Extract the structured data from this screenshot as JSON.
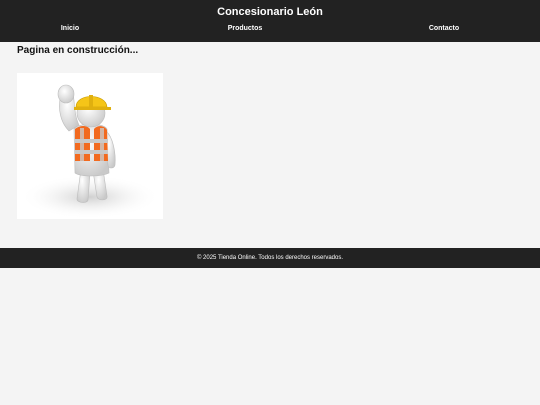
{
  "header": {
    "title": "Concesionario León",
    "nav": {
      "inicio": "Inicio",
      "productos": "Productos",
      "contacto": "Contacto"
    }
  },
  "main": {
    "heading": "Pagina en construcción...",
    "image": {
      "icon": "construction-worker-icon"
    }
  },
  "footer": {
    "text": "© 2025 Tienda Online. Todos los derechos reservados."
  },
  "colors": {
    "header_bg": "#222222",
    "footer_bg": "#222222",
    "page_bg": "#f4f4f4",
    "vest": "#f26a1f",
    "helmet": "#f5c518"
  }
}
